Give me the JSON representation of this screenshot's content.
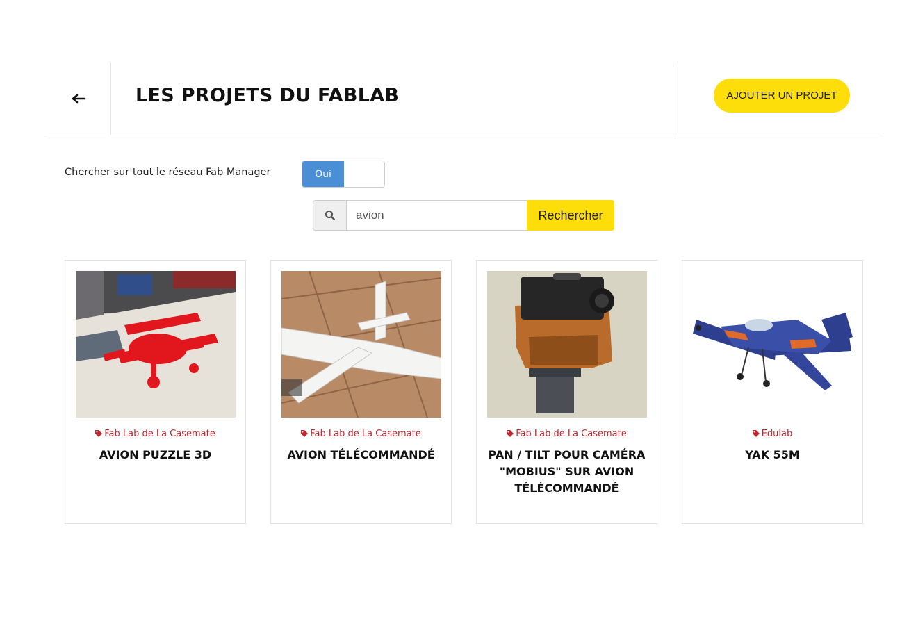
{
  "header": {
    "title": "LES PROJETS DU FABLAB",
    "add_button": "AJOUTER UN PROJET",
    "back_icon": "arrow-left-icon"
  },
  "filters": {
    "network_label": "Chercher sur tout le réseau Fab Manager",
    "network_toggle": {
      "on_label": "Oui",
      "value": true,
      "accent": "#4a8fd6"
    }
  },
  "search": {
    "icon": "search-icon",
    "value": "avion",
    "button": "Rechercher",
    "accent": "#fdde0b"
  },
  "projects": [
    {
      "source": "Fab Lab de La Casemate",
      "title": "AVION PUZZLE 3D",
      "image": "red-puzzle-biplane"
    },
    {
      "source": "Fab Lab de La Casemate",
      "title": "AVION TÉLÉCOMMANDÉ",
      "image": "white-rc-plane-on-tiles"
    },
    {
      "source": "Fab Lab de La Casemate",
      "title": "PAN / TILT POUR CAMÉRA \"MOBIUS\" SUR AVION TÉLÉCOMMANDÉ",
      "image": "camera-pan-tilt-mount"
    },
    {
      "source": "Edulab",
      "title": "YAK 55M",
      "image": "blue-aerobatic-plane"
    }
  ],
  "colors": {
    "source_tag": "#c0272d",
    "button_yellow": "#fdde0b"
  }
}
